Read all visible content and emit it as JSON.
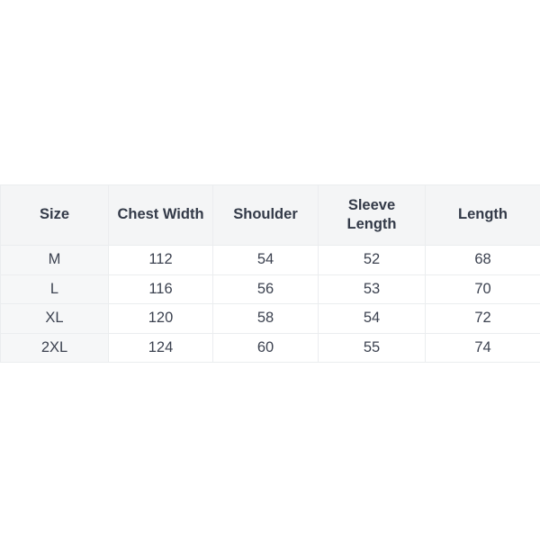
{
  "table": {
    "headers": [
      {
        "label": "Size",
        "key": "size"
      },
      {
        "label": "Chest Width",
        "key": "chest_width"
      },
      {
        "label": "Shoulder",
        "key": "shoulder"
      },
      {
        "label": "Sleeve Length",
        "key": "sleeve_length"
      },
      {
        "label": "Length",
        "key": "length"
      }
    ],
    "rows": [
      {
        "size": "M",
        "chest_width": "112",
        "shoulder": "54",
        "sleeve_length": "52",
        "length": "68"
      },
      {
        "size": "L",
        "chest_width": "116",
        "shoulder": "56",
        "sleeve_length": "53",
        "length": "70"
      },
      {
        "size": "XL",
        "chest_width": "120",
        "shoulder": "58",
        "sleeve_length": "54",
        "length": "72"
      },
      {
        "size": "2XL",
        "chest_width": "124",
        "shoulder": "60",
        "sleeve_length": "55",
        "length": "74"
      }
    ]
  },
  "colors": {
    "page_background": "#ffffff",
    "header_background": "#f4f5f6",
    "size_column_background": "#f6f7f8",
    "cell_background": "#ffffff",
    "border": "#ebedef",
    "header_text": "#333a48",
    "cell_text": "#3c4250"
  }
}
